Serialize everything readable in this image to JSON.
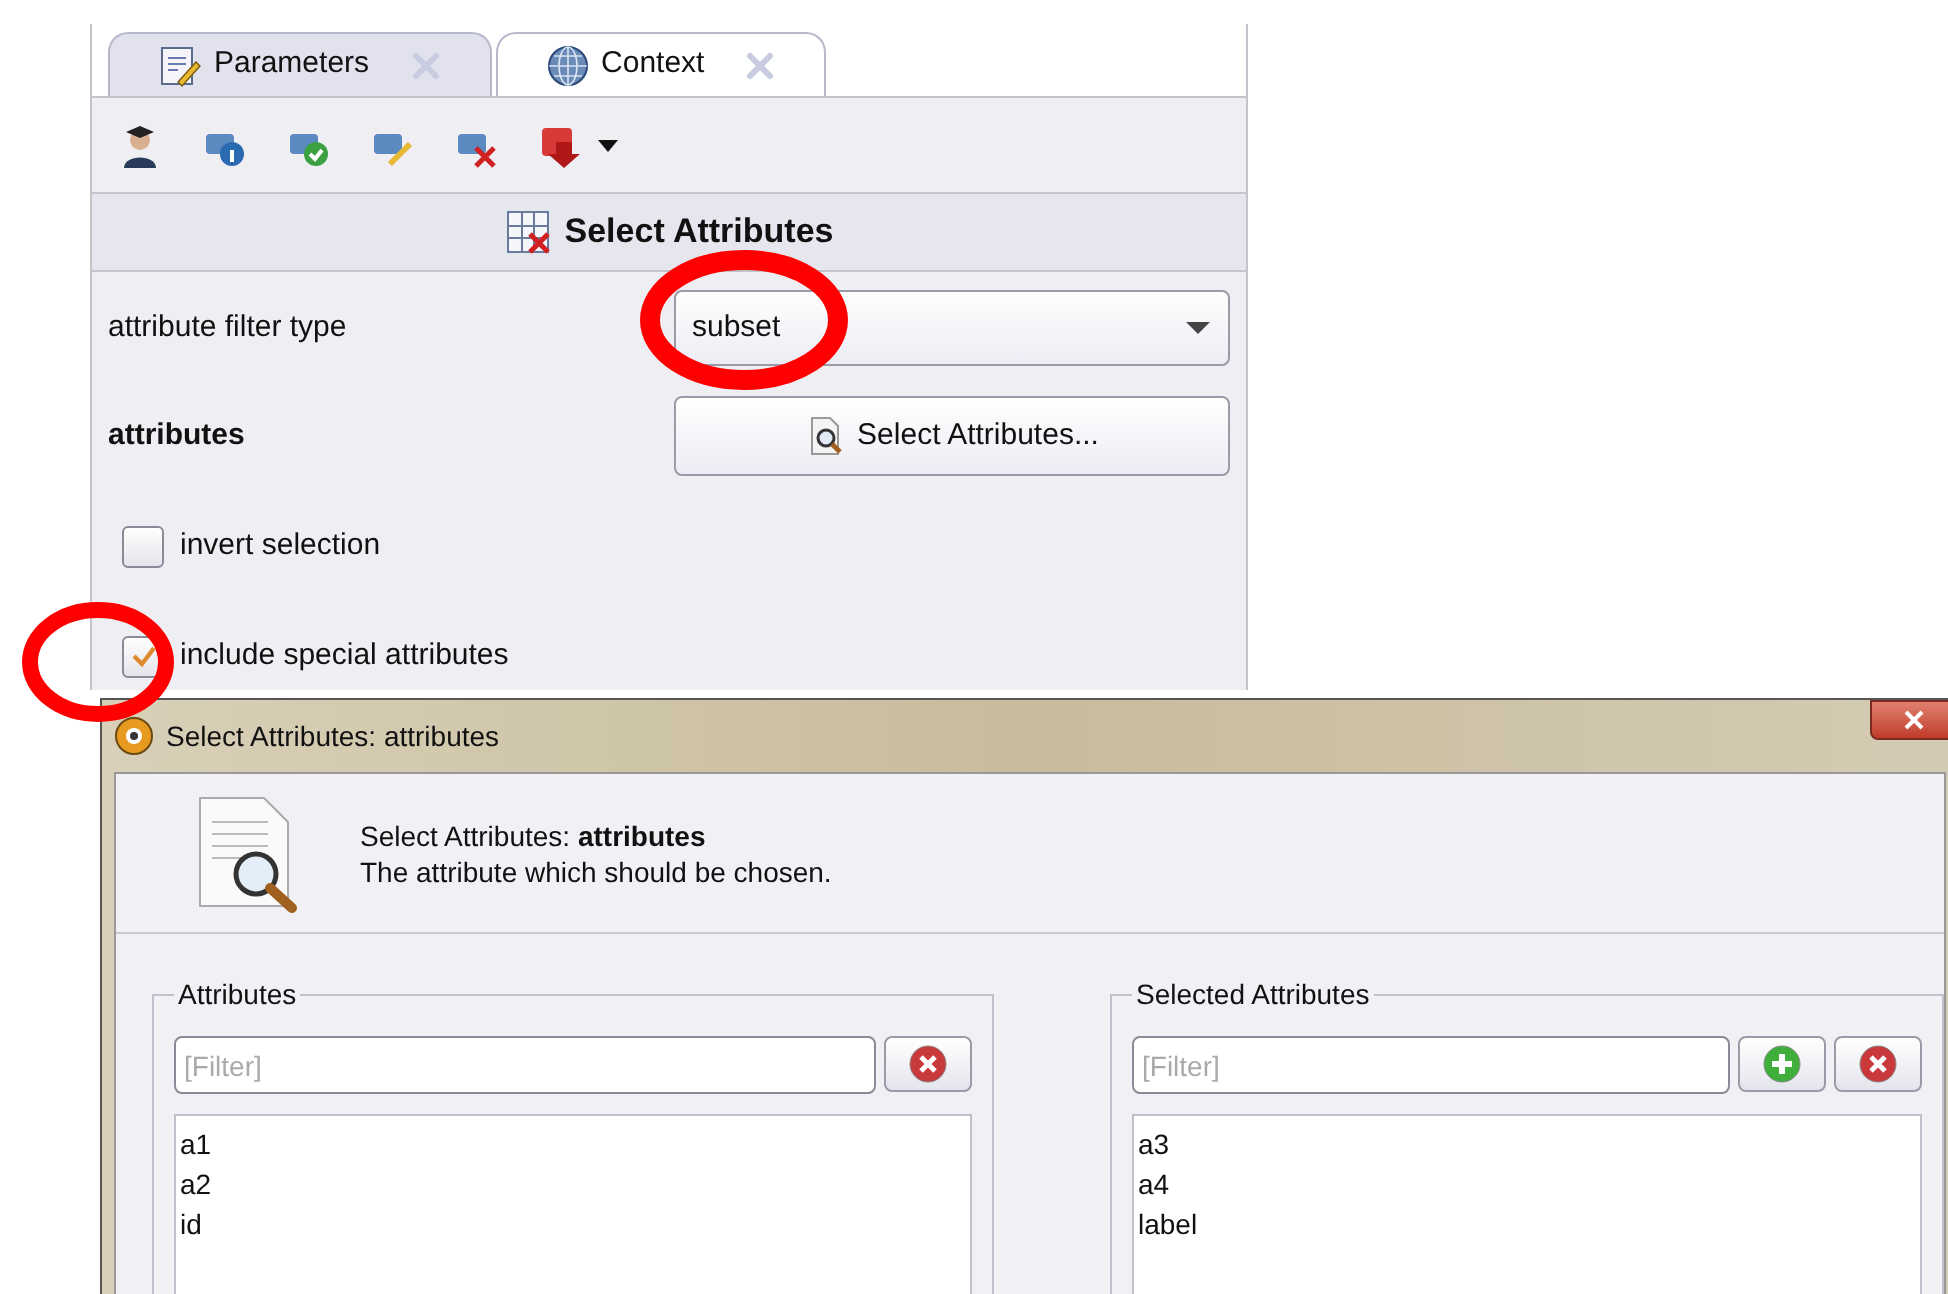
{
  "panel": {
    "tabs": [
      {
        "label": "Parameters",
        "selected": true
      },
      {
        "label": "Context",
        "selected": false
      }
    ],
    "header": "Select Attributes",
    "filter_type": {
      "label": "attribute filter type",
      "value": "subset"
    },
    "attributes": {
      "label": "attributes",
      "button": "Select Attributes..."
    },
    "options": [
      {
        "label": "invert selection",
        "checked": false
      },
      {
        "label": "include special attributes",
        "checked": true
      }
    ]
  },
  "dialog": {
    "title": "Select Attributes: attributes",
    "heading": "Select Attributes: **attributes**",
    "description": "The attribute which should be chosen.",
    "lists": [
      {
        "title": "Attributes",
        "placeholder": "[Filter]",
        "add_button": false,
        "items": [
          "a1",
          "a2",
          "id"
        ]
      },
      {
        "title": "Selected Attributes",
        "placeholder": "[Filter]",
        "add_button": true,
        "items": [
          "a3",
          "a4",
          "label"
        ]
      }
    ]
  }
}
